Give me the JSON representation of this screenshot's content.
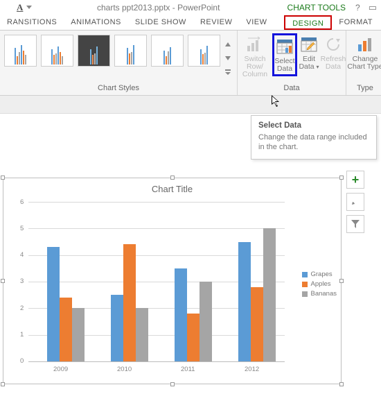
{
  "titlebar": {
    "document": "charts ppt2013.pptx - PowerPoint",
    "contextual": "CHART TOOLS"
  },
  "tabs": {
    "transitions": "RANSITIONS",
    "animations": "ANIMATIONS",
    "slideshow": "SLIDE SHOW",
    "review": "REVIEW",
    "view": "VIEW",
    "design": "DESIGN",
    "format": "FORMAT"
  },
  "ribbon": {
    "styles_label": "Chart Styles",
    "switch": {
      "l1": "Switch Row/",
      "l2": "Column"
    },
    "select": {
      "l1": "Select",
      "l2": "Data"
    },
    "edit": {
      "l1": "Edit",
      "l2": "Data"
    },
    "refresh": {
      "l1": "Refresh",
      "l2": "Data"
    },
    "data_label": "Data",
    "change": {
      "l1": "Change",
      "l2": "Chart Type"
    },
    "type_label": "Type"
  },
  "tooltip": {
    "title": "Select Data",
    "body": "Change the data range included in the chart."
  },
  "chart_title": "Chart Title",
  "legend": {
    "s1": "Grapes",
    "s2": "Apples",
    "s3": "Bananas"
  },
  "y_ticks": {
    "t0": "0",
    "t1": "1",
    "t2": "2",
    "t3": "3",
    "t4": "4",
    "t5": "5",
    "t6": "6"
  },
  "x_ticks": {
    "x1": "2009",
    "x2": "2010",
    "x3": "2011",
    "x4": "2012"
  },
  "chart_data": {
    "type": "bar",
    "title": "Chart Title",
    "categories": [
      "2009",
      "2010",
      "2011",
      "2012"
    ],
    "series": [
      {
        "name": "Grapes",
        "values": [
          4.3,
          2.5,
          3.5,
          4.5
        ]
      },
      {
        "name": "Apples",
        "values": [
          2.4,
          4.4,
          1.8,
          2.8
        ]
      },
      {
        "name": "Bananas",
        "values": [
          2.0,
          2.0,
          3.0,
          5.0
        ]
      }
    ],
    "xlabel": "",
    "ylabel": "",
    "ylim": [
      0,
      6
    ],
    "colors": {
      "Grapes": "#5b9bd5",
      "Apples": "#ed7d31",
      "Bananas": "#a5a5a5"
    }
  }
}
